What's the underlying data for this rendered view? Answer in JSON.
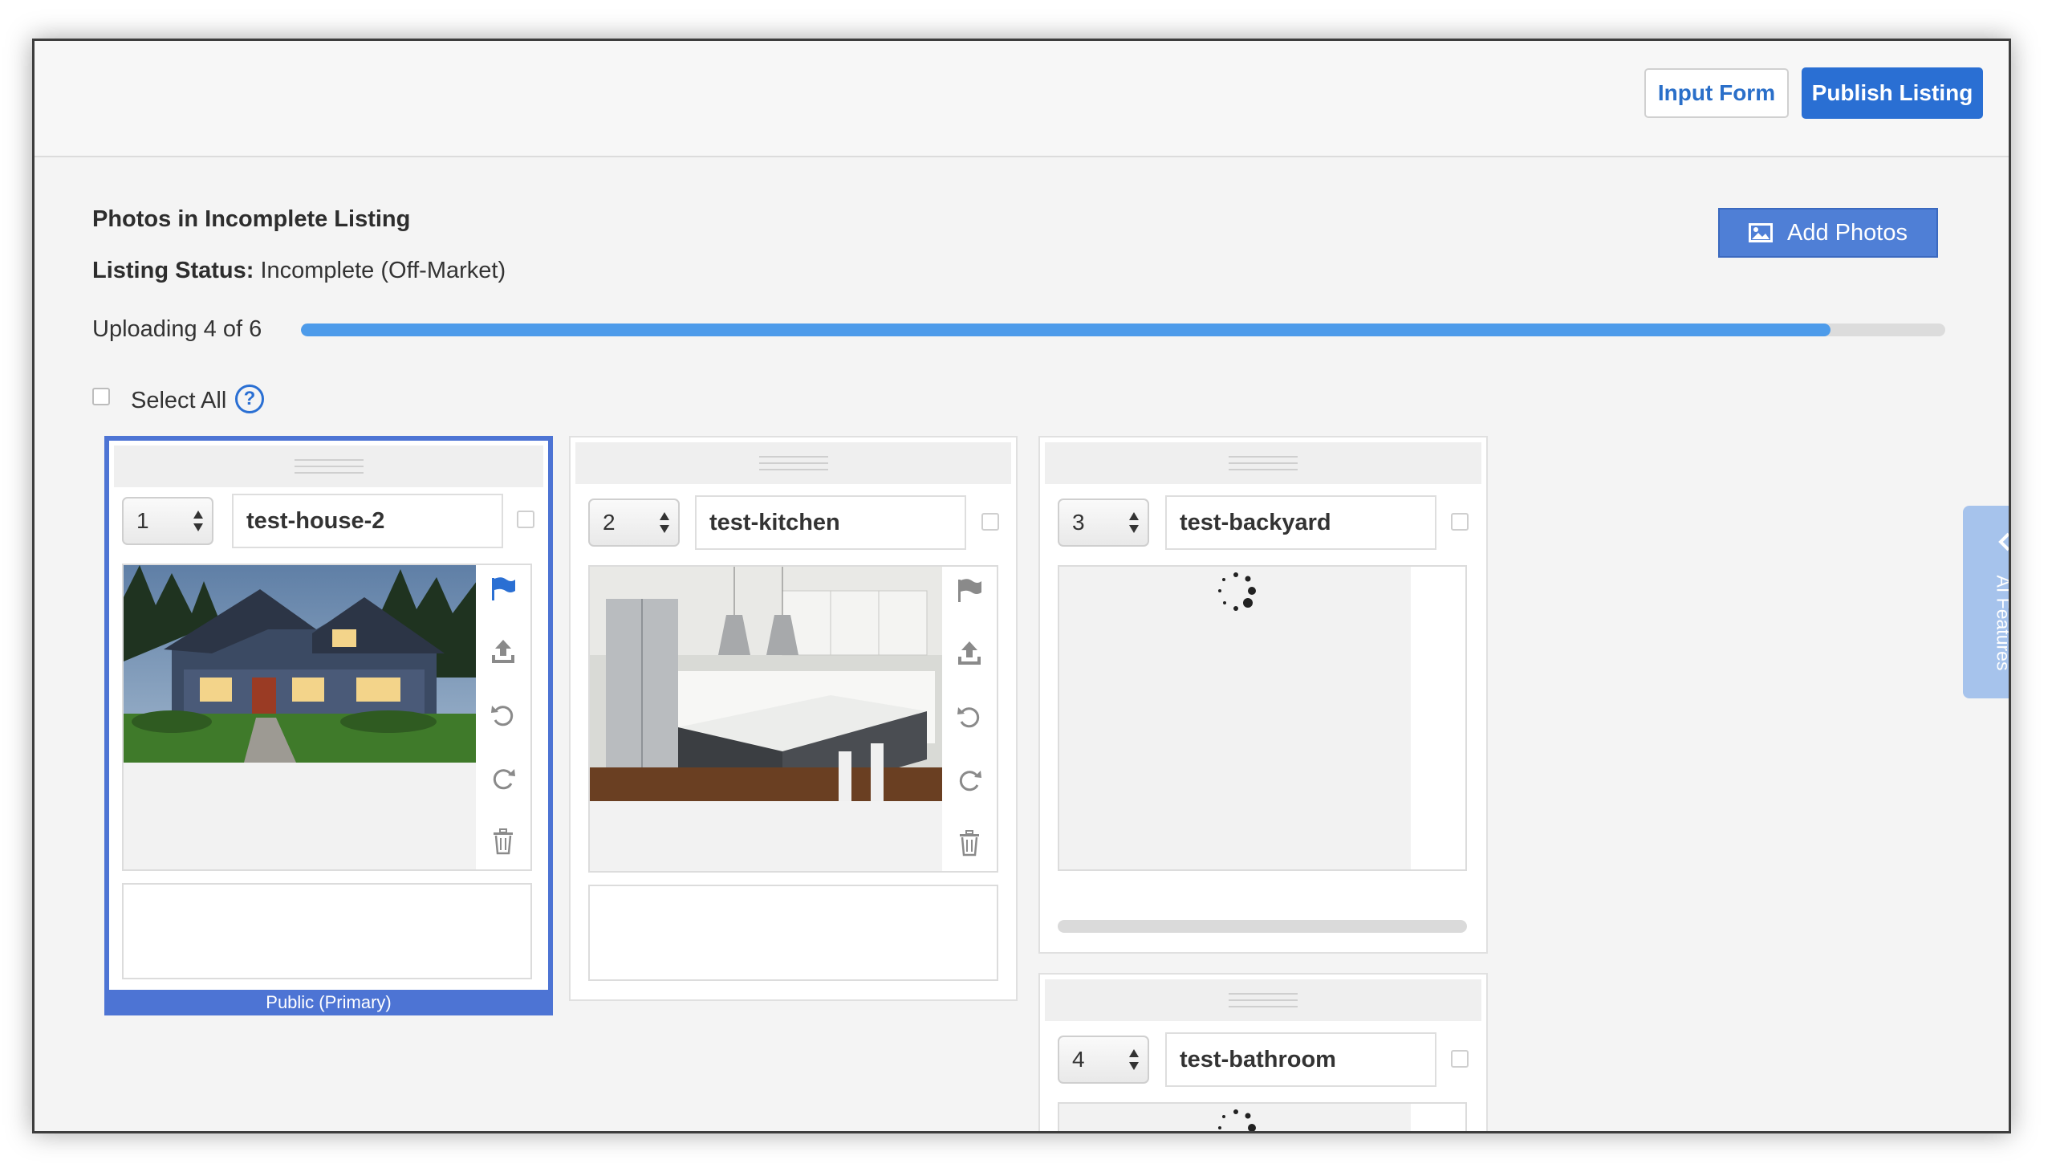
{
  "toolbar": {
    "input_form_label": "Input Form",
    "publish_label": "Publish Listing"
  },
  "header": {
    "title": "Photos in Incomplete Listing",
    "status_label": "Listing Status:",
    "status_value": "Incomplete (Off-Market)",
    "add_photos_label": "Add Photos",
    "add_photos_icon": "image-icon"
  },
  "upload": {
    "label": "Uploading 4 of 6",
    "progress": 0.93,
    "bar_color": "#4d9bea"
  },
  "select_all": {
    "label": "Select All",
    "help_glyph": "?"
  },
  "photos": [
    {
      "order": "1",
      "name": "test-house-2",
      "state": "loaded",
      "badge": "Public (Primary)"
    },
    {
      "order": "2",
      "name": "test-kitchen",
      "state": "loaded"
    },
    {
      "order": "3",
      "name": "test-backyard",
      "state": "uploading"
    },
    {
      "order": "4",
      "name": "test-bathroom",
      "state": "uploading"
    }
  ],
  "tools": [
    "flag-icon",
    "upload-icon",
    "rotate-left-icon",
    "rotate-right-icon",
    "trash-icon"
  ],
  "side_tab": {
    "label": "AI Features",
    "icon": "chevron-left-icon"
  },
  "colors": {
    "accent": "#2a6fd3",
    "primary_border": "#4d74d4",
    "ai_tab": "#a6c3ec"
  }
}
